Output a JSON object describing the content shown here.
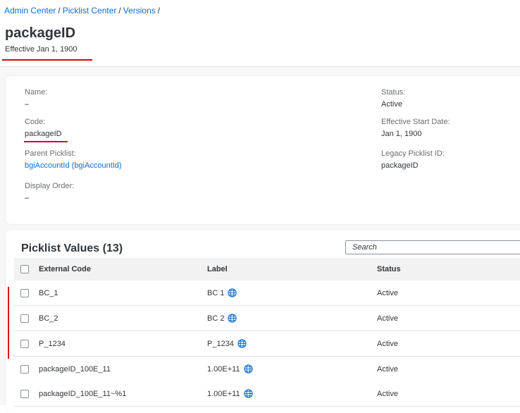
{
  "breadcrumb": {
    "items": [
      "Admin Center",
      "Picklist Center",
      "Versions"
    ],
    "separator": "/"
  },
  "header": {
    "title": "packageID",
    "subtitle": "Effective Jan 1, 1900"
  },
  "details": {
    "name_label": "Name:",
    "name_value": "–",
    "code_label": "Code:",
    "code_value": "packageID",
    "parent_label": "Parent Picklist:",
    "parent_value": "bgiAccountId (bgiAccountId)",
    "order_label": "Display Order:",
    "order_value": "–",
    "status_label": "Status:",
    "status_value": "Active",
    "start_label": "Effective Start Date:",
    "start_value": "Jan 1, 1900",
    "legacy_label": "Legacy Picklist ID:",
    "legacy_value": "packageID"
  },
  "table": {
    "title": "Picklist Values (13)",
    "search_placeholder": "Search",
    "columns": [
      "External Code",
      "Label",
      "Status"
    ],
    "rows": [
      {
        "code": "BC_1",
        "label": "BC 1",
        "status": "Active"
      },
      {
        "code": "BC_2",
        "label": "BC 2",
        "status": "Active"
      },
      {
        "code": "P_1234",
        "label": "P_1234",
        "status": "Active"
      },
      {
        "code": "packageID_100E_11",
        "label": "1.00E+11",
        "status": "Active"
      },
      {
        "code": "packageID_100E_11~%1",
        "label": "1.00E+11",
        "status": "Active"
      }
    ]
  },
  "colors": {
    "link": "#0a6ed1",
    "annotation_red": "#e1000f",
    "header_bg": "#f2f2f2"
  },
  "icons": {
    "translation": "globe-icon"
  }
}
